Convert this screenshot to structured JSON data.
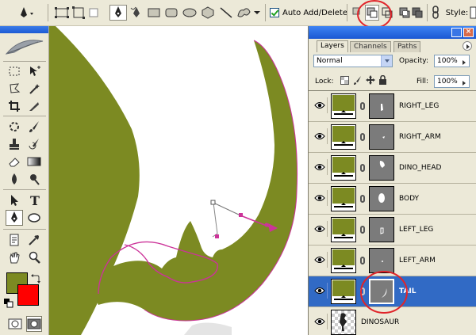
{
  "options_bar": {
    "auto_add_delete_label": "Auto Add/Delete",
    "auto_add_delete_checked": true,
    "style_label": "Style:"
  },
  "layers_panel": {
    "tabs": [
      "Layers",
      "Channels",
      "Paths"
    ],
    "active_tab": "Layers",
    "blend_mode": "Normal",
    "opacity_label": "Opacity:",
    "opacity_value": "100%",
    "lock_label": "Lock:",
    "fill_label": "Fill:",
    "fill_value": "100%",
    "layers": [
      {
        "name": "RIGHT_LEG",
        "selected": false
      },
      {
        "name": "RIGHT_ARM",
        "selected": false
      },
      {
        "name": "DINO_HEAD",
        "selected": false
      },
      {
        "name": "BODY",
        "selected": false
      },
      {
        "name": "LEFT_LEG",
        "selected": false
      },
      {
        "name": "LEFT_ARM",
        "selected": false
      },
      {
        "name": "TAIL",
        "selected": true
      },
      {
        "name": "DINOSAUR",
        "selected": false
      }
    ]
  },
  "colors": {
    "foreground": "#7c8a22",
    "background": "#ff0000",
    "shape_fill": "#7c8a22",
    "path_stroke": "#cc3399",
    "annotation_circle": "#e0242a",
    "selected_layer": "#316ac5"
  }
}
